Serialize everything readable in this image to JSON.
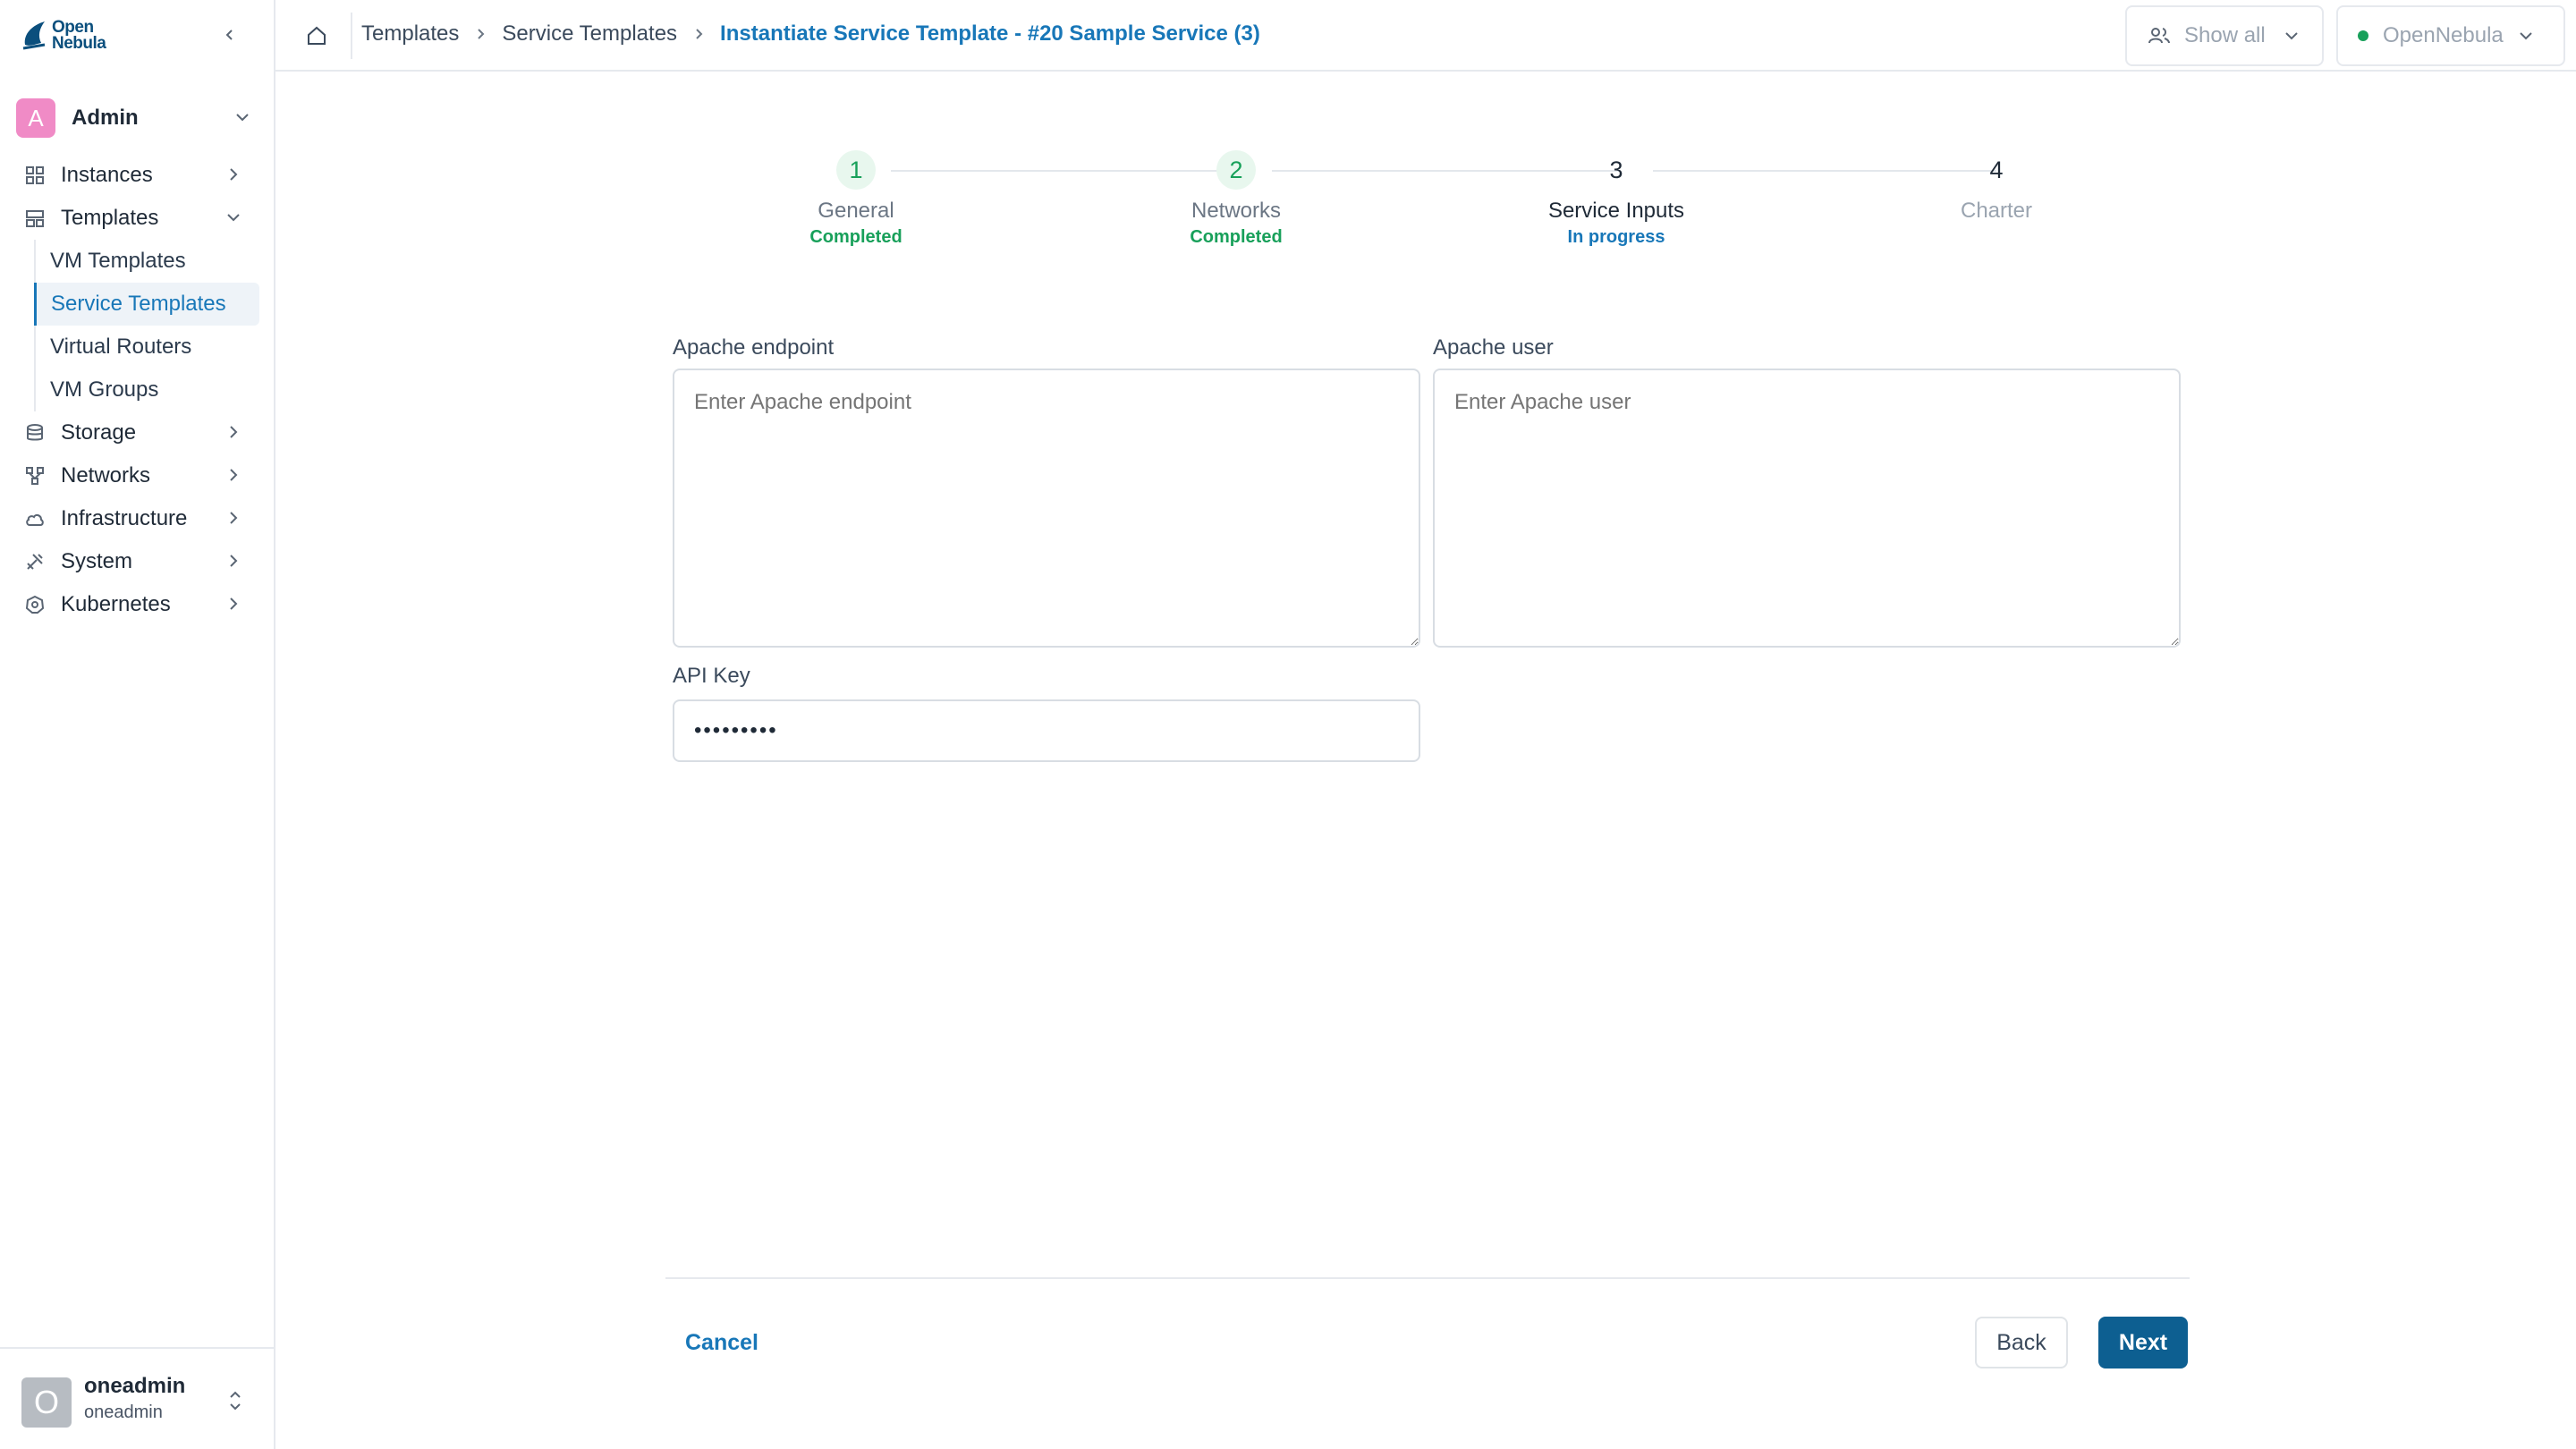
{
  "brand": {
    "logo_line1": "Open",
    "logo_line2": "Nebula"
  },
  "group": {
    "avatar_letter": "A",
    "name": "Admin"
  },
  "sidebar": {
    "items": [
      {
        "label": "Instances",
        "icon": "grid-icon"
      },
      {
        "label": "Templates",
        "icon": "templates-icon",
        "expanded": true,
        "children": [
          "VM Templates",
          "Service Templates",
          "Virtual Routers",
          "VM Groups"
        ],
        "active_child": "Service Templates"
      },
      {
        "label": "Storage",
        "icon": "storage-icon"
      },
      {
        "label": "Networks",
        "icon": "network-icon"
      },
      {
        "label": "Infrastructure",
        "icon": "cloud-icon"
      },
      {
        "label": "System",
        "icon": "tools-icon"
      },
      {
        "label": "Kubernetes",
        "icon": "kubernetes-icon"
      }
    ]
  },
  "user": {
    "avatar_letter": "O",
    "name": "oneadmin",
    "sub": "oneadmin"
  },
  "header": {
    "breadcrumbs": [
      "Templates",
      "Service Templates",
      "Instantiate Service Template - #20 Sample Service (3)"
    ],
    "show_all_label": "Show all",
    "zone_label": "OpenNebula"
  },
  "stepper": {
    "steps": [
      {
        "num": "1",
        "label": "General",
        "status": "Completed",
        "state": "done"
      },
      {
        "num": "2",
        "label": "Networks",
        "status": "Completed",
        "state": "done"
      },
      {
        "num": "3",
        "label": "Service Inputs",
        "status": "In progress",
        "state": "active"
      },
      {
        "num": "4",
        "label": "Charter",
        "status": "",
        "state": "todo"
      }
    ]
  },
  "form": {
    "apache_endpoint": {
      "label": "Apache endpoint",
      "placeholder": "Enter Apache endpoint",
      "value": ""
    },
    "apache_user": {
      "label": "Apache user",
      "placeholder": "Enter Apache user",
      "value": ""
    },
    "api_key": {
      "label": "API Key",
      "value": "•••••••••"
    }
  },
  "footer": {
    "cancel_label": "Cancel",
    "back_label": "Back",
    "next_label": "Next"
  },
  "colors": {
    "accent": "#1877b8",
    "primary_button": "#0d5f91",
    "success": "#18a05a",
    "group_avatar": "#f08bc6"
  }
}
